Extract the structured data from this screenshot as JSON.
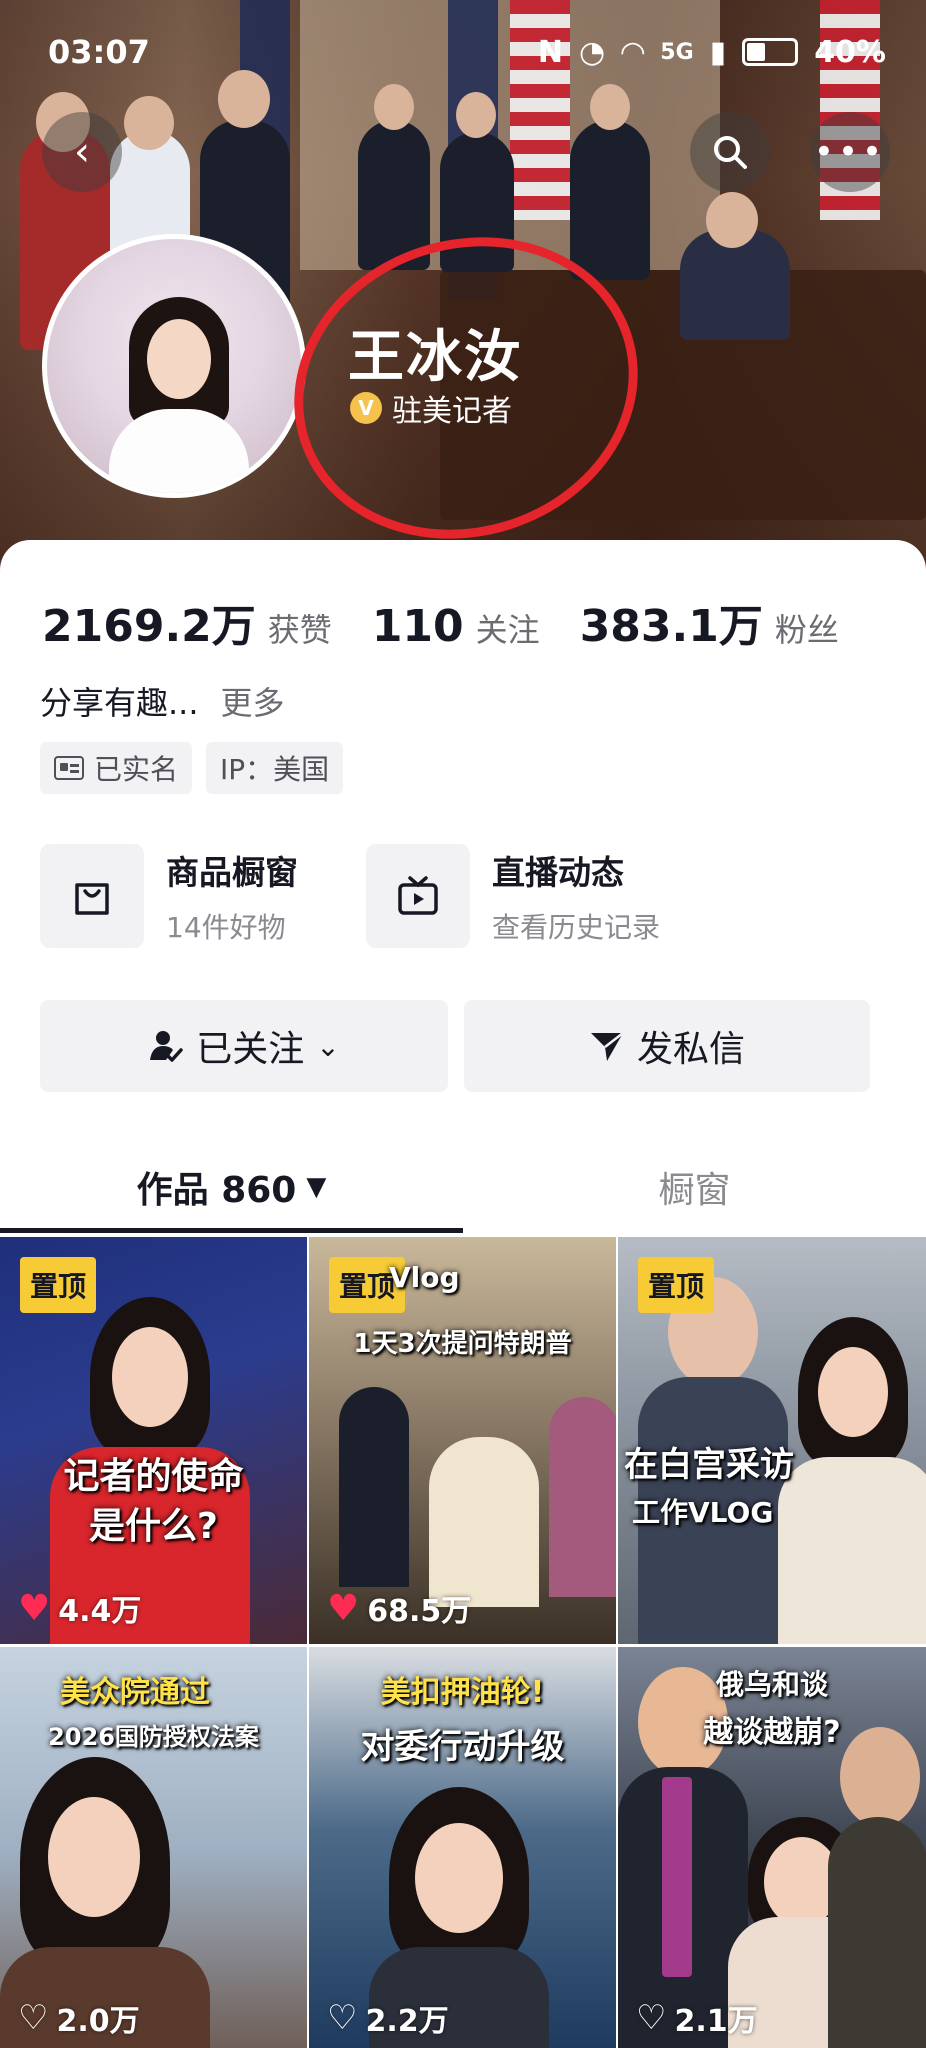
{
  "status_bar": {
    "time": "03:07",
    "network": "5G",
    "battery": "40%",
    "battery_level": 0.4
  },
  "profile": {
    "name": "王冰汝",
    "verification": "驻美记者",
    "stats": [
      {
        "value": "2169.2万",
        "label": "获赞"
      },
      {
        "value": "110",
        "label": "关注"
      },
      {
        "value": "383.1万",
        "label": "粉丝"
      }
    ],
    "bio": "分享有趣...",
    "bio_more": "更多",
    "tags": [
      "已实名",
      "IP：美国"
    ]
  },
  "services": [
    {
      "title": "商品橱窗",
      "subtitle": "14件好物",
      "icon": "shopping-bag-icon"
    },
    {
      "title": "直播动态",
      "subtitle": "查看历史记录",
      "icon": "tv-icon"
    }
  ],
  "actions": {
    "follow": "已关注",
    "message": "发私信"
  },
  "tabs": {
    "works": "作品 860",
    "shop": "橱窗"
  },
  "videos": [
    {
      "pinned": "置顶",
      "caption_top": "记者的使命",
      "caption_bottom": "是什么?",
      "likes": "4.4万",
      "liked": true
    },
    {
      "pinned": "置顶",
      "caption_top": "Vlog",
      "caption_bottom": "1天3次提问特朗普",
      "likes": "68.5万",
      "liked": true
    },
    {
      "pinned": "置顶",
      "caption_top": "在白宫采访",
      "caption_bottom": "工作VLOG",
      "likes": "",
      "liked": false
    },
    {
      "pinned": "",
      "caption_top": "美众院通过",
      "caption_bottom": "2026国防授权法案",
      "likes": "2.0万",
      "liked": false
    },
    {
      "pinned": "",
      "caption_top": "美扣押油轮!",
      "caption_bottom": "对委行动升级",
      "likes": "2.2万",
      "liked": false
    },
    {
      "pinned": "",
      "caption_top": "俄乌和谈",
      "caption_bottom": "越谈越崩?",
      "likes": "2.1万",
      "liked": false
    }
  ],
  "colors": {
    "accent_red": "#fe2c55",
    "pin_yellow": "#f6cb36",
    "annotation_red": "#e5242c"
  }
}
